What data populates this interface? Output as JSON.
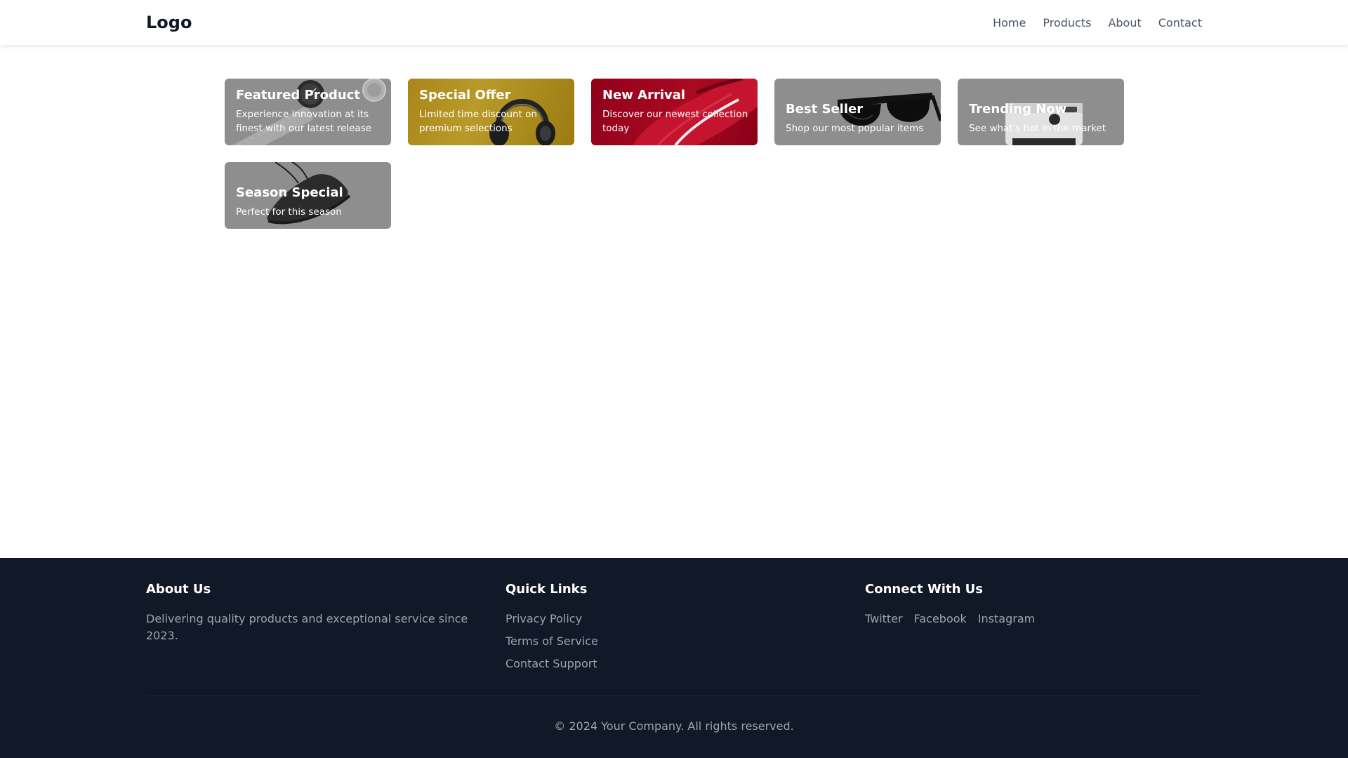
{
  "header": {
    "logo": "Logo",
    "nav": [
      "Home",
      "Products",
      "About",
      "Contact"
    ]
  },
  "cards": [
    {
      "title": "Featured Product",
      "description": "Experience innovation at its finest with our latest release",
      "theme": "#8e8e8e",
      "icon": "watch-icon"
    },
    {
      "title": "Special Offer",
      "description": "Limited time discount on premium selections",
      "theme": "#a9861a",
      "icon": "headphones-icon"
    },
    {
      "title": "New Arrival",
      "description": "Discover our newest collection today",
      "theme": "#8f0019",
      "icon": "sneaker-icon"
    },
    {
      "title": "Best Seller",
      "description": "Shop our most popular items",
      "theme": "#8e8e8e",
      "icon": "sunglasses-icon"
    },
    {
      "title": "Trending Now",
      "description": "See what's hot in the market",
      "theme": "#8e8e8e",
      "icon": "camera-icon"
    },
    {
      "title": "Season Special",
      "description": "Perfect for this season",
      "theme": "#8e8e8e",
      "icon": "shoe-icon"
    }
  ],
  "footer": {
    "about": {
      "title": "About Us",
      "text": "Delivering quality products and exceptional service since 2023."
    },
    "quick_links": {
      "title": "Quick Links",
      "links": [
        "Privacy Policy",
        "Terms of Service",
        "Contact Support"
      ]
    },
    "connect": {
      "title": "Connect With Us",
      "links": [
        "Twitter",
        "Facebook",
        "Instagram"
      ]
    },
    "copyright": "© 2024 Your Company. All rights reserved."
  }
}
